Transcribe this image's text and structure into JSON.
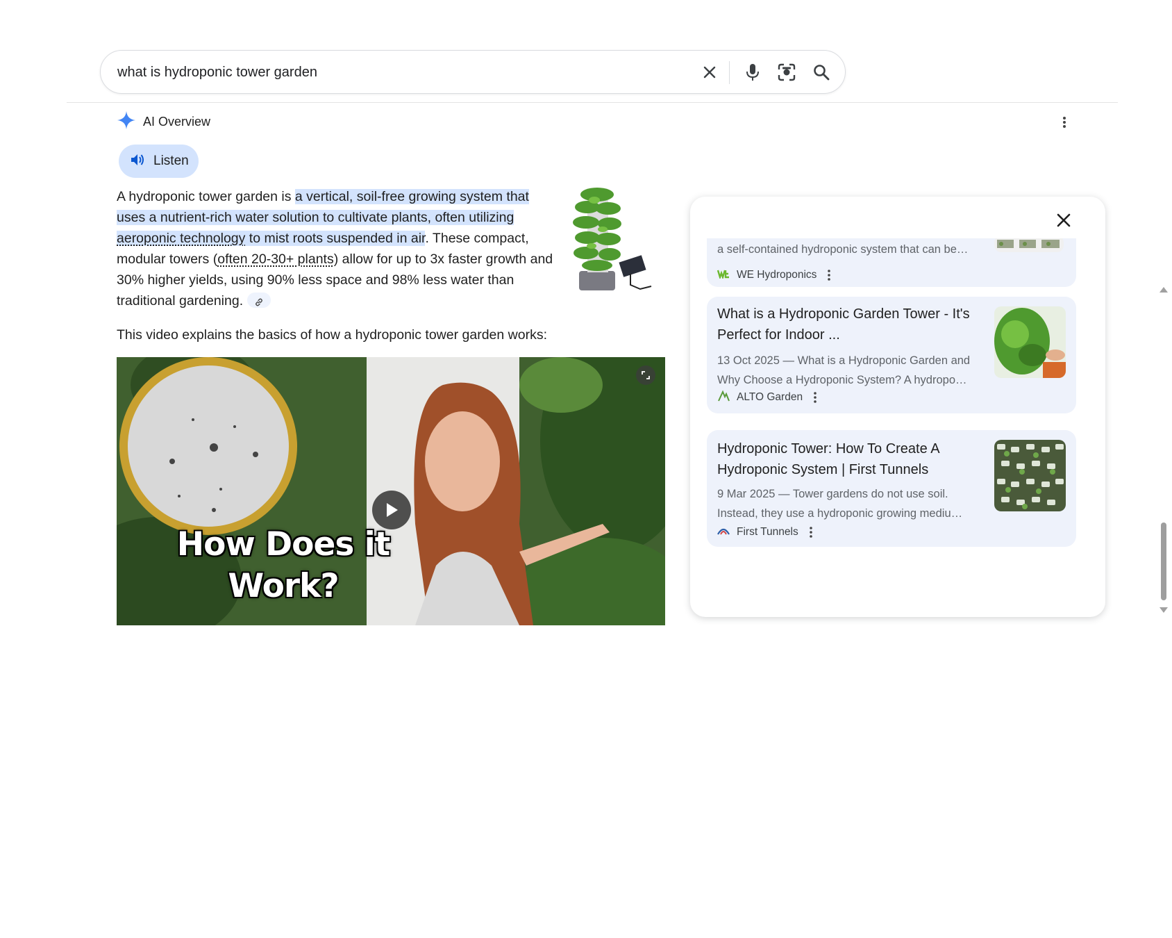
{
  "search": {
    "query": "what is hydroponic tower garden"
  },
  "ai_overview": {
    "title": "AI Overview",
    "listen_label": "Listen",
    "answer": {
      "part1": "A hydroponic tower garden is ",
      "highlight_a": "a vertical, soil-free growing system that uses a nutrient-rich water solution to cultivate plants, often utilizing ",
      "highlight_link": "aeroponic technology",
      "highlight_b": " to mist roots suspended in air",
      "part2": ". These compact, modular towers (",
      "dotted": "often 20-30+ plants",
      "part3": ") allow for up to 3x faster growth and 30% higher yields, using 90% less space and 98% less water than traditional gardening."
    },
    "video_caption": "This video explains the basics of how a hydroponic tower garden works:",
    "video": {
      "overlay_line1": "How Does it",
      "overlay_line2": "Work?"
    }
  },
  "sources_panel": {
    "cards": [
      {
        "snippet": "a self-contained hydroponic system that can be…",
        "source": "WE Hydroponics",
        "favicon": "we-hydroponics-logo"
      },
      {
        "title": "What is a Hydroponic Garden Tower - It's Perfect for Indoor ...",
        "snippet": "13 Oct 2025 — What is a Hydroponic Garden and Why Choose a Hydroponic System? A hydropo…",
        "source": "ALTO Garden",
        "favicon": "alto-garden-logo"
      },
      {
        "title": "Hydroponic Tower: How To Create A Hydroponic System | First Tunnels",
        "snippet": "9 Mar 2025 — Tower gardens do not use soil. Instead, they use a hydroponic growing mediu…",
        "source": "First Tunnels",
        "favicon": "first-tunnels-logo"
      }
    ]
  },
  "colors": {
    "highlight": "#d3e3fd",
    "card_bg": "#eef2fb",
    "gemini_blue": "#4285f4"
  }
}
